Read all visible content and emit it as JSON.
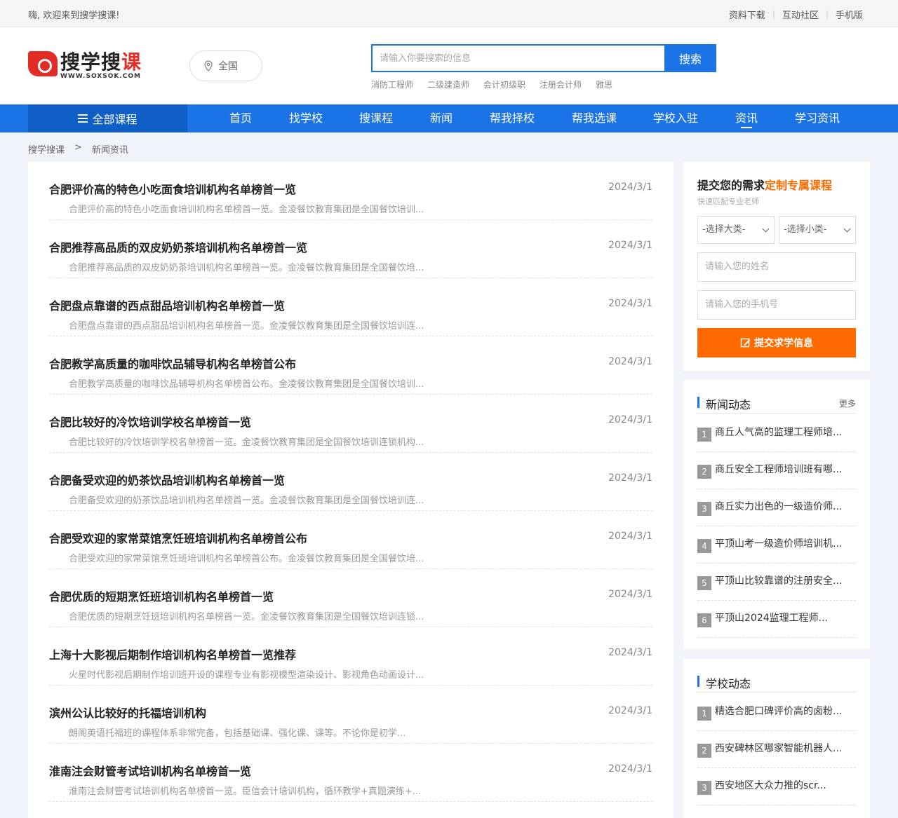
{
  "topbar": {
    "welcome": "嗨, 欢迎来到搜学搜课!",
    "links": [
      "资料下载",
      "互动社区",
      "手机版"
    ]
  },
  "logo": {
    "name_a": "搜学搜",
    "name_b": "课",
    "url": "WWW.SOXSOK.COM"
  },
  "region": {
    "label": "全国"
  },
  "search": {
    "placeholder": "请输入你要搜索的信息",
    "button": "搜索",
    "hotwords": [
      "消防工程师",
      "二级建造师",
      "会计初级职",
      "注册会计师",
      "雅思"
    ]
  },
  "nav": {
    "all": "全部课程",
    "items": [
      "首页",
      "找学校",
      "搜课程",
      "新闻",
      "帮我择校",
      "帮我选课",
      "学校入驻",
      "资讯",
      "学习资讯"
    ]
  },
  "breadcrumb": [
    "搜学搜课",
    ">",
    "新闻资讯"
  ],
  "news": [
    {
      "title": "合肥评价高的特色小吃面食培训机构名单榜首一览",
      "date": "2024/3/1",
      "summary": "合肥评价高的特色小吃面食培训机构名单榜首一览。金凌餐饮教育集团是全国餐饮培训..."
    },
    {
      "title": "合肥推荐高品质的双皮奶奶茶培训机构名单榜首一览",
      "date": "2024/3/1",
      "summary": "合肥推荐高品质的双皮奶奶茶培训机构名单榜首一览。金凌餐饮教育集团是全国餐饮培..."
    },
    {
      "title": "合肥盘点靠谱的西点甜品培训机构名单榜首一览",
      "date": "2024/3/1",
      "summary": "合肥盘点靠谱的西点甜品培训机构名单榜首一览。金凌餐饮教育集团是全国餐饮培训连..."
    },
    {
      "title": "合肥教学高质量的咖啡饮品辅导机构名单榜首公布",
      "date": "2024/3/1",
      "summary": "合肥教学高质量的咖啡饮品辅导机构名单榜首公布。金凌餐饮教育集团是全国餐饮培训..."
    },
    {
      "title": "合肥比较好的冷饮培训学校名单榜首一览",
      "date": "2024/3/1",
      "summary": "合肥比较好的冷饮培训学校名单榜首一览。金凌餐饮教育集团是全国餐饮培训连锁机构..."
    },
    {
      "title": "合肥备受欢迎的奶茶饮品培训机构名单榜首一览",
      "date": "2024/3/1",
      "summary": "合肥备受欢迎的奶茶饮品培训机构名单榜首一览。金凌餐饮教育集团是全国餐饮培训连..."
    },
    {
      "title": "合肥受欢迎的家常菜馆烹饪班培训机构名单榜首公布",
      "date": "2024/3/1",
      "summary": "合肥受欢迎的家常菜馆烹饪班培训机构名单榜首公布。金凌餐饮教育集团是全国餐饮培..."
    },
    {
      "title": "合肥优质的短期烹饪班培训机构名单榜首一览",
      "date": "2024/3/1",
      "summary": "合肥优质的短期烹饪班培训机构名单榜首一览。金凌餐饮教育集团是全国餐饮培训连锁..."
    },
    {
      "title": "上海十大影视后期制作培训机构名单榜首一览推荐",
      "date": "2024/3/1",
      "summary": "火星时代影视后期制作培训班开设的课程专业有影视模型渲染设计、影视角色动画设计..."
    },
    {
      "title": "滨州公认比较好的托福培训机构",
      "date": "2024/3/1",
      "summary": "朗阁英语托福班的课程体系非常完备，包括基础课、强化课、课等。不论你是初学..."
    },
    {
      "title": "淮南注会财管考试培训机构名单榜首一览",
      "date": "2024/3/1",
      "summary": "淮南注会财管考试培训机构名单榜首一览。臣信会计培训机构，循环教学+真题演练+..."
    }
  ],
  "form": {
    "title_a": "提交您的需求",
    "title_b": "定制专属课程",
    "subtitle": "快速匹配专业老师",
    "select_big": "-选择大类-",
    "select_small": "-选择小类-",
    "name_placeholder": "请输入您的姓名",
    "phone_placeholder": "请输入您的手机号",
    "submit": "提交求学信息"
  },
  "news_dynamic": {
    "title": "新闻动态",
    "more": "更多",
    "items": [
      {
        "num": "1",
        "text": "商丘人气高的监理工程师培..."
      },
      {
        "num": "2",
        "text": "商丘安全工程师培训班有哪..."
      },
      {
        "num": "3",
        "text": "商丘实力出色的一级造价师..."
      },
      {
        "num": "4",
        "text": "平顶山考一级造价师培训机..."
      },
      {
        "num": "5",
        "text": "平顶山比较靠谱的注册安全..."
      },
      {
        "num": "6",
        "text": "平顶山2024监理工程师..."
      }
    ]
  },
  "school_dynamic": {
    "title": "学校动态",
    "items": [
      {
        "num": "1",
        "text": "精选合肥口碑评价高的卤粉..."
      },
      {
        "num": "2",
        "text": "西安碑林区哪家智能机器人..."
      },
      {
        "num": "3",
        "text": "西安地区大众力推的scr..."
      }
    ]
  },
  "colors": {
    "primary": "#1b74e6",
    "accent": "#ff6a00",
    "brand_red": "#e32c25"
  }
}
